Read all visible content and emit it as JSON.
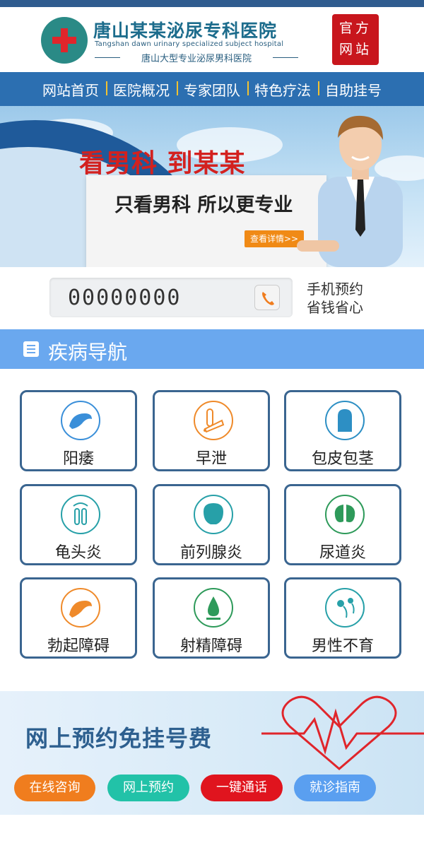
{
  "header": {
    "hospital_name": "唐山某某泌尿专科医院",
    "hospital_name_en": "Tangshan dawn urinary specialized subject hospital",
    "subtitle": "唐山大型专业泌尿男科医院",
    "seal_line1": "官方",
    "seal_line2": "网站"
  },
  "nav": {
    "items": [
      "网站首页",
      "医院概况",
      "专家团队",
      "特色疗法",
      "自助挂号"
    ]
  },
  "banner": {
    "title": "看男科  到某某",
    "subtitle": "只看男科  所以更专业",
    "button": "查看详情>>"
  },
  "phone": {
    "number": "00000000",
    "text_line1": "手机预约",
    "text_line2": "省钱省心"
  },
  "section": {
    "title": "疾病导航"
  },
  "diseases": [
    {
      "label": "阳痿",
      "color": "#3a8fd9"
    },
    {
      "label": "早泄",
      "color": "#ef8a2a"
    },
    {
      "label": "包皮包茎",
      "color": "#2d8fc4"
    },
    {
      "label": "龟头炎",
      "color": "#27a0a8"
    },
    {
      "label": "前列腺炎",
      "color": "#27a0a8"
    },
    {
      "label": "尿道炎",
      "color": "#2e9a5a"
    },
    {
      "label": "勃起障碍",
      "color": "#ef8a2a"
    },
    {
      "label": "射精障碍",
      "color": "#2e9a5a"
    },
    {
      "label": "男性不育",
      "color": "#27a0a8"
    }
  ],
  "bottom": {
    "title": "网上预约免挂号费",
    "buttons": [
      {
        "label": "在线咨询",
        "color": "#f07d1e"
      },
      {
        "label": "网上预约",
        "color": "#22c2a8"
      },
      {
        "label": "一键通话",
        "color": "#e0141e"
      },
      {
        "label": "就诊指南",
        "color": "#5a9ff0"
      }
    ]
  }
}
